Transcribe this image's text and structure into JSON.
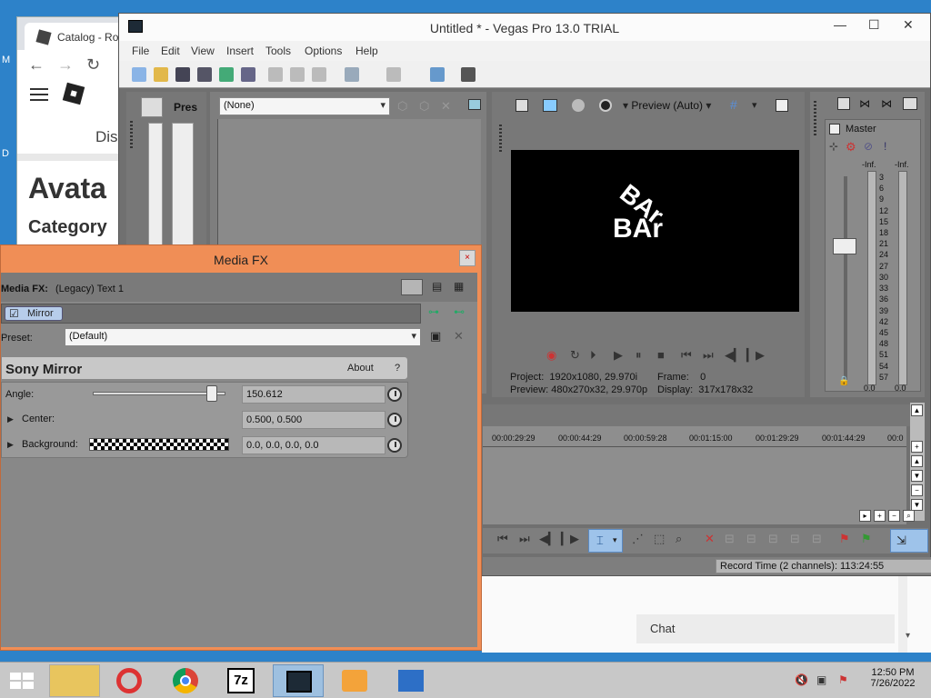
{
  "chrome": {
    "tab_title": "Catalog - Ro",
    "nav_back": "←",
    "nav_forward": "→",
    "nav_reload": "↻",
    "page_dis": "Dis",
    "heading": "Avata",
    "subheading": "Category"
  },
  "vegas": {
    "title": "Untitled * - Vegas Pro 13.0 TRIAL",
    "menu": [
      "File",
      "Edit",
      "View",
      "Insert",
      "Tools",
      "Options",
      "Help"
    ],
    "effects_panel_label": "Pres",
    "effects_dropdown": "(None)",
    "preview_quality": "Preview (Auto)",
    "preview_text_top": "BAr",
    "preview_text_bottom": "BAr",
    "project_label": "Project:",
    "project_value": "1920x1080, 29.970i",
    "preview_label": "Preview:",
    "preview_value": "480x270x32, 29.970p",
    "frame_label": "Frame:",
    "frame_value": "0",
    "display_label": "Display:",
    "display_value": "317x178x32",
    "master_label": "Master",
    "meter_left_top": "-Inf.",
    "meter_right_top": "-Inf.",
    "meter_scale": [
      "3",
      "6",
      "9",
      "12",
      "15",
      "18",
      "21",
      "24",
      "27",
      "30",
      "33",
      "36",
      "39",
      "42",
      "45",
      "48",
      "51",
      "54",
      "57"
    ],
    "meter_left_bottom": "0.0",
    "meter_right_bottom": "0.0",
    "timecodes": [
      "00:00:29:29",
      "00:00:44:29",
      "00:00:59:28",
      "00:01:15:00",
      "00:01:29:29",
      "00:01:44:29",
      "00:0"
    ],
    "record_time": "Record Time (2 channels): 113:24:55"
  },
  "mediafx": {
    "title": "Media FX",
    "close": "×",
    "chain_label": "Media FX:",
    "chain_value": "(Legacy) Text 1",
    "plugin_chip": "Mirror",
    "preset_label": "Preset:",
    "preset_value": "(Default)",
    "plugin_name": "Sony Mirror",
    "about": "About",
    "help": "?",
    "angle_label": "Angle:",
    "angle_value": "150.612",
    "angle_slider_fraction": 0.9,
    "center_label": "Center:",
    "center_value": "0.500, 0.500",
    "background_label": "Background:",
    "background_value": "0.0, 0.0, 0.0, 0.0"
  },
  "chat_label": "Chat",
  "taskbar": {
    "time": "12:50 PM",
    "date": "7/26/2022"
  }
}
